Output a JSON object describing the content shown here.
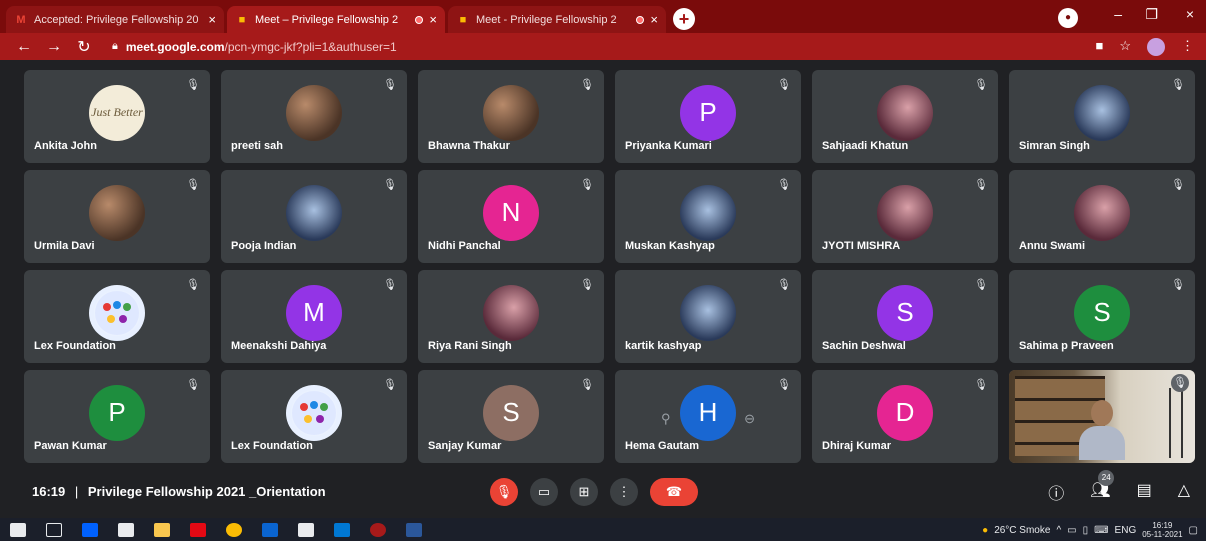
{
  "browser": {
    "tabs": [
      {
        "title": "Accepted: Privilege Fellowship 20",
        "close": "×",
        "favicon": "gmail-icon",
        "active": false,
        "recording": false
      },
      {
        "title": "Meet – Privilege Fellowship 2",
        "close": "×",
        "favicon": "meet-icon",
        "active": true,
        "recording": true
      },
      {
        "title": "Meet - Privilege Fellowship 2",
        "close": "×",
        "favicon": "meet-icon",
        "active": false,
        "recording": true
      }
    ],
    "new_tab": "+",
    "window": {
      "minimize": "–",
      "restore": "❐",
      "close": "×"
    },
    "url_host": "meet.google.com",
    "url_path": "/pcn-ymgc-jkf?pli=1&authuser=1"
  },
  "participants": [
    {
      "name": "Ankita John",
      "avatar": "quote",
      "letter": "Just Better",
      "color": "#f3ecd9"
    },
    {
      "name": "preeti sah",
      "avatar": "photo",
      "letter": "",
      "color": ""
    },
    {
      "name": "Bhawna Thakur",
      "avatar": "photo",
      "letter": "",
      "color": ""
    },
    {
      "name": "Priyanka Kumari",
      "avatar": "letter",
      "letter": "P",
      "color": "#9334e6"
    },
    {
      "name": "Sahjaadi Khatun",
      "avatar": "photo2",
      "letter": "",
      "color": ""
    },
    {
      "name": "Simran Singh",
      "avatar": "photo3",
      "letter": "",
      "color": ""
    },
    {
      "name": "Urmila Davi",
      "avatar": "photo",
      "letter": "",
      "color": ""
    },
    {
      "name": "Pooja Indian",
      "avatar": "photo3",
      "letter": "",
      "color": ""
    },
    {
      "name": "Nidhi Panchal",
      "avatar": "letter",
      "letter": "N",
      "color": "#e52592"
    },
    {
      "name": "Muskan Kashyap",
      "avatar": "photo3",
      "letter": "",
      "color": ""
    },
    {
      "name": "JYOTI MISHRA",
      "avatar": "photo2",
      "letter": "",
      "color": ""
    },
    {
      "name": "Annu Swami",
      "avatar": "photo2",
      "letter": "",
      "color": ""
    },
    {
      "name": "Lex Foundation",
      "avatar": "lex",
      "letter": "",
      "color": ""
    },
    {
      "name": "Meenakshi Dahiya",
      "avatar": "letter",
      "letter": "M",
      "color": "#9334e6"
    },
    {
      "name": "Riya Rani Singh",
      "avatar": "photo2",
      "letter": "",
      "color": ""
    },
    {
      "name": "kartik kashyap",
      "avatar": "photo3",
      "letter": "",
      "color": ""
    },
    {
      "name": "Sachin Deshwal",
      "avatar": "letter",
      "letter": "S",
      "color": "#9334e6"
    },
    {
      "name": "Sahima p Praveen",
      "avatar": "letter",
      "letter": "S",
      "color": "#1e8e3e"
    },
    {
      "name": "Pawan Kumar",
      "avatar": "letter",
      "letter": "P",
      "color": "#1e8e3e"
    },
    {
      "name": "Lex Foundation",
      "avatar": "lex",
      "letter": "",
      "color": ""
    },
    {
      "name": "Sanjay Kumar",
      "avatar": "letter",
      "letter": "S",
      "color": "#8d6e63"
    },
    {
      "name": "Hema Gautam",
      "avatar": "letter",
      "letter": "H",
      "color": "#1967d2"
    },
    {
      "name": "Dhiraj Kumar",
      "avatar": "letter",
      "letter": "D",
      "color": "#e52592"
    },
    {
      "name": "",
      "avatar": "video",
      "letter": "",
      "color": ""
    }
  ],
  "meeting": {
    "time": "16:19",
    "separator": "|",
    "title": "Privilege Fellowship 2021 _Orientation",
    "participant_count": "24"
  },
  "taskbar": {
    "weather": "26°C Smoke",
    "lang": "ENG",
    "time": "16:19",
    "date": "05-11-2021"
  },
  "colors": {
    "tab_strip": "#7a0b0b",
    "active_tab": "#a61a1a",
    "meet_bg": "#202124",
    "tile_bg": "#3c4043",
    "hangup": "#ea4335"
  }
}
